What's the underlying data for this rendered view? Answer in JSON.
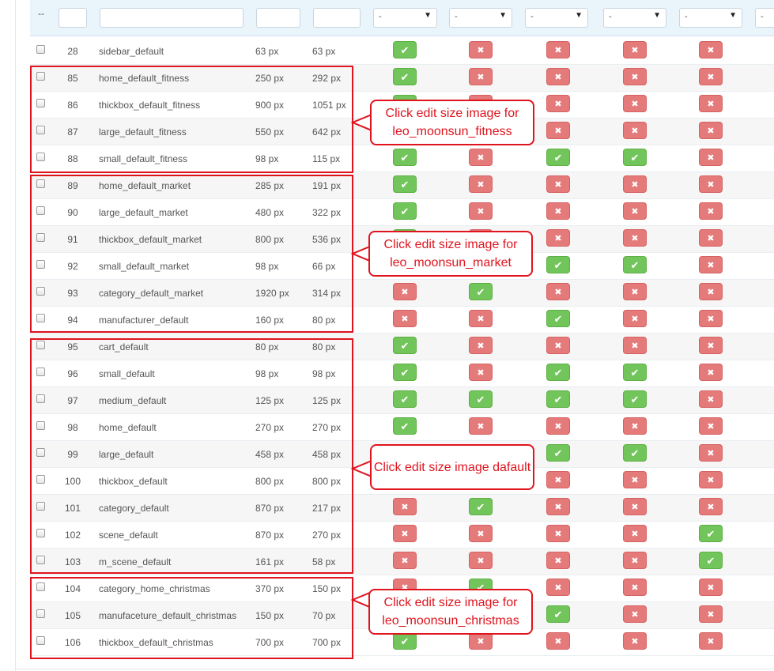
{
  "filter": {
    "dash": "--",
    "selects": [
      "-",
      "-",
      "-",
      "-",
      "-",
      "-"
    ]
  },
  "table": {
    "rows": [
      {
        "id": "28",
        "name": "sidebar_default",
        "width": "63 px",
        "height": "63 px",
        "flags": [
          1,
          0,
          0,
          0,
          0
        ]
      },
      {
        "id": "85",
        "name": "home_default_fitness",
        "width": "250 px",
        "height": "292 px",
        "flags": [
          1,
          0,
          0,
          0,
          0
        ]
      },
      {
        "id": "86",
        "name": "thickbox_default_fitness",
        "width": "900 px",
        "height": "1051 px",
        "flags": [
          1,
          0,
          0,
          0,
          0
        ]
      },
      {
        "id": "87",
        "name": "large_default_fitness",
        "width": "550 px",
        "height": "642 px",
        "flags": [
          1,
          0,
          0,
          0,
          0
        ]
      },
      {
        "id": "88",
        "name": "small_default_fitness",
        "width": "98 px",
        "height": "115 px",
        "flags": [
          1,
          0,
          1,
          1,
          0
        ]
      },
      {
        "id": "89",
        "name": "home_default_market",
        "width": "285 px",
        "height": "191 px",
        "flags": [
          1,
          0,
          0,
          0,
          0
        ]
      },
      {
        "id": "90",
        "name": "large_default_market",
        "width": "480 px",
        "height": "322 px",
        "flags": [
          1,
          0,
          0,
          0,
          0
        ]
      },
      {
        "id": "91",
        "name": "thickbox_default_market",
        "width": "800 px",
        "height": "536 px",
        "flags": [
          1,
          0,
          0,
          0,
          0
        ]
      },
      {
        "id": "92",
        "name": "small_default_market",
        "width": "98 px",
        "height": "66 px",
        "flags": [
          1,
          0,
          1,
          1,
          0
        ]
      },
      {
        "id": "93",
        "name": "category_default_market",
        "width": "1920 px",
        "height": "314 px",
        "flags": [
          0,
          1,
          0,
          0,
          0
        ]
      },
      {
        "id": "94",
        "name": "manufacturer_default",
        "width": "160 px",
        "height": "80 px",
        "flags": [
          0,
          0,
          1,
          0,
          0
        ]
      },
      {
        "id": "95",
        "name": "cart_default",
        "width": "80 px",
        "height": "80 px",
        "flags": [
          1,
          0,
          0,
          0,
          0
        ]
      },
      {
        "id": "96",
        "name": "small_default",
        "width": "98 px",
        "height": "98 px",
        "flags": [
          1,
          0,
          1,
          1,
          0
        ]
      },
      {
        "id": "97",
        "name": "medium_default",
        "width": "125 px",
        "height": "125 px",
        "flags": [
          1,
          1,
          1,
          1,
          0
        ]
      },
      {
        "id": "98",
        "name": "home_default",
        "width": "270 px",
        "height": "270 px",
        "flags": [
          1,
          0,
          0,
          0,
          0
        ]
      },
      {
        "id": "99",
        "name": "large_default",
        "width": "458 px",
        "height": "458 px",
        "flags": [
          1,
          0,
          1,
          1,
          0
        ]
      },
      {
        "id": "100",
        "name": "thickbox_default",
        "width": "800 px",
        "height": "800 px",
        "flags": [
          1,
          0,
          0,
          0,
          0
        ]
      },
      {
        "id": "101",
        "name": "category_default",
        "width": "870 px",
        "height": "217 px",
        "flags": [
          0,
          1,
          0,
          0,
          0
        ]
      },
      {
        "id": "102",
        "name": "scene_default",
        "width": "870 px",
        "height": "270 px",
        "flags": [
          0,
          0,
          0,
          0,
          1
        ]
      },
      {
        "id": "103",
        "name": "m_scene_default",
        "width": "161 px",
        "height": "58 px",
        "flags": [
          0,
          0,
          0,
          0,
          1
        ]
      },
      {
        "id": "104",
        "name": "category_home_christmas",
        "width": "370 px",
        "height": "150 px",
        "flags": [
          0,
          1,
          0,
          0,
          0
        ]
      },
      {
        "id": "105",
        "name": "manufaceture_default_christmas",
        "width": "150 px",
        "height": "70 px",
        "flags": [
          0,
          0,
          1,
          0,
          0
        ]
      },
      {
        "id": "106",
        "name": "thickbox_default_christmas",
        "width": "700 px",
        "height": "700 px",
        "flags": [
          1,
          0,
          0,
          0,
          0
        ]
      }
    ]
  },
  "annotations": [
    {
      "text": "Click edit size image for leo_moonsun_fitness"
    },
    {
      "text": "Click edit size image for leo_moonsun_market"
    },
    {
      "text": "Click edit size image dafault"
    },
    {
      "text": "Click edit size image for leo_moonsun_christmas"
    }
  ],
  "icons": {
    "yes": "check-icon",
    "no": "cross-icon"
  },
  "colors": {
    "yes": "#72c55a",
    "no": "#e57a7a",
    "annotation": "#e0141e"
  }
}
